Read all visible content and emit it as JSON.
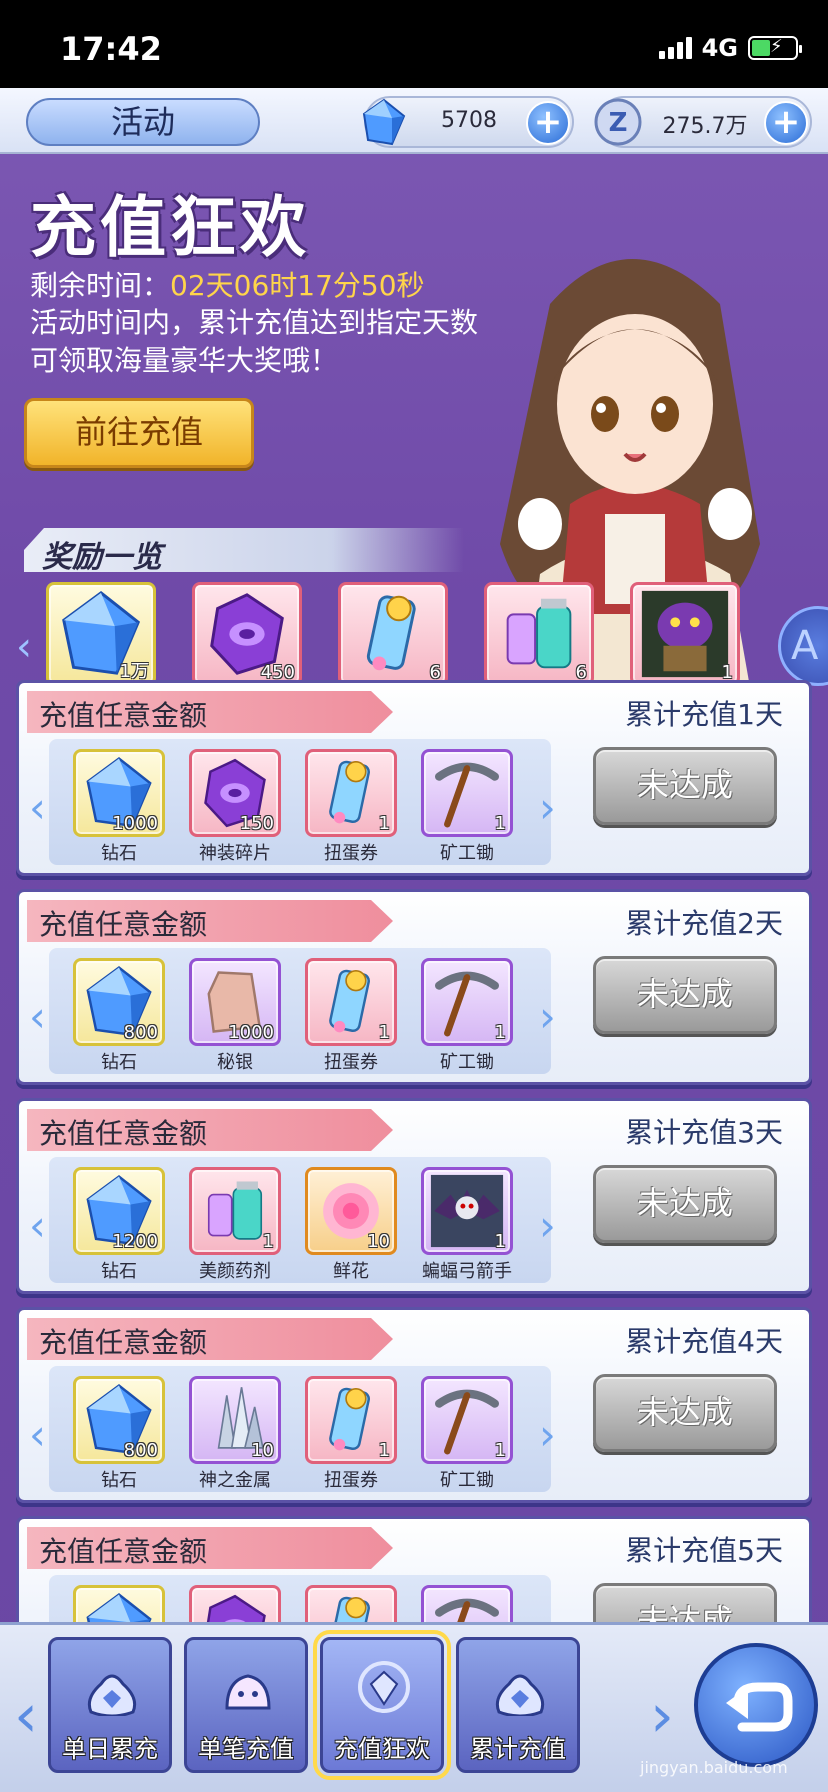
{
  "status_bar": {
    "time": "17:42",
    "network": "4G"
  },
  "topbar": {
    "tab_label": "活动",
    "gems": "5708",
    "coins": "275.7万"
  },
  "banner": {
    "title": "充值狂欢",
    "time_label": "剩余时间：",
    "time_value": "02天06时17分50秒",
    "desc": "活动时间内，累计充值达到指定天数可领取海量豪华大奖哦！",
    "goto_button": "前往充值"
  },
  "overview": {
    "label": "奖励一览",
    "items": [
      {
        "name": "钻石",
        "count": "1万",
        "icon": "diamond-icon",
        "quality": "yellow"
      },
      {
        "name": "神装碎片",
        "count": "450",
        "icon": "purple-shard-icon",
        "quality": "red"
      },
      {
        "name": "扭蛋券",
        "count": "6",
        "icon": "gacha-ticket-icon",
        "quality": "red"
      },
      {
        "name": "美颜药剂",
        "count": "6",
        "icon": "potion-icon",
        "quality": "red"
      },
      {
        "name": "堕落的大神官希巴",
        "count": "1",
        "icon": "monster-icon",
        "quality": "red"
      }
    ]
  },
  "rows": [
    {
      "ribbon": "充值任意金额",
      "day": "累计充值1天",
      "status": "未达成",
      "items": [
        {
          "name": "钻石",
          "count": "1000",
          "icon": "diamond-icon",
          "quality": "yellow"
        },
        {
          "name": "神装碎片",
          "count": "150",
          "icon": "purple-shard-icon",
          "quality": "red"
        },
        {
          "name": "扭蛋券",
          "count": "1",
          "icon": "gacha-ticket-icon",
          "quality": "red"
        },
        {
          "name": "矿工锄",
          "count": "1",
          "icon": "pickaxe-icon",
          "quality": "purple"
        }
      ]
    },
    {
      "ribbon": "充值任意金额",
      "day": "累计充值2天",
      "status": "未达成",
      "items": [
        {
          "name": "钻石",
          "count": "800",
          "icon": "diamond-icon",
          "quality": "yellow"
        },
        {
          "name": "秘银",
          "count": "1000",
          "icon": "mithril-icon",
          "quality": "purple"
        },
        {
          "name": "扭蛋券",
          "count": "1",
          "icon": "gacha-ticket-icon",
          "quality": "red"
        },
        {
          "name": "矿工锄",
          "count": "1",
          "icon": "pickaxe-icon",
          "quality": "purple"
        }
      ]
    },
    {
      "ribbon": "充值任意金额",
      "day": "累计充值3天",
      "status": "未达成",
      "items": [
        {
          "name": "钻石",
          "count": "1200",
          "icon": "diamond-icon",
          "quality": "yellow"
        },
        {
          "name": "美颜药剂",
          "count": "1",
          "icon": "potion-icon",
          "quality": "red"
        },
        {
          "name": "鲜花",
          "count": "10",
          "icon": "flower-icon",
          "quality": "orange"
        },
        {
          "name": "蝙蝠弓箭手",
          "count": "1",
          "icon": "bat-archer-icon",
          "quality": "purple"
        }
      ]
    },
    {
      "ribbon": "充值任意金额",
      "day": "累计充值4天",
      "status": "未达成",
      "items": [
        {
          "name": "钻石",
          "count": "800",
          "icon": "diamond-icon",
          "quality": "yellow"
        },
        {
          "name": "神之金属",
          "count": "10",
          "icon": "crystal-icon",
          "quality": "purple"
        },
        {
          "name": "扭蛋券",
          "count": "1",
          "icon": "gacha-ticket-icon",
          "quality": "red"
        },
        {
          "name": "矿工锄",
          "count": "1",
          "icon": "pickaxe-icon",
          "quality": "purple"
        }
      ]
    },
    {
      "ribbon": "充值任意金额",
      "day": "累计充值5天",
      "status": "未达成",
      "items": [
        {
          "name": "",
          "count": "",
          "icon": "diamond-icon",
          "quality": "yellow"
        },
        {
          "name": "",
          "count": "",
          "icon": "purple-shard-icon",
          "quality": "red"
        },
        {
          "name": "",
          "count": "",
          "icon": "gacha-ticket-icon",
          "quality": "red"
        },
        {
          "name": "",
          "count": "",
          "icon": "pickaxe-icon",
          "quality": "purple"
        }
      ]
    }
  ],
  "bottom_nav": {
    "tabs": [
      {
        "label": "单日累充",
        "icon": "moneybag-icon",
        "active": false
      },
      {
        "label": "单笔充值",
        "icon": "slime-icon",
        "active": false
      },
      {
        "label": "充值狂欢",
        "icon": "diamond-cycle-icon",
        "active": true
      },
      {
        "label": "累计充值",
        "icon": "moneybag-icon",
        "active": false
      }
    ]
  },
  "watermark": "jingyan.baidu.com",
  "colors": {
    "accent_gold": "#ffd54a",
    "panel_purple": "#6f4aa8",
    "button_gray": "#9a9a9a"
  }
}
